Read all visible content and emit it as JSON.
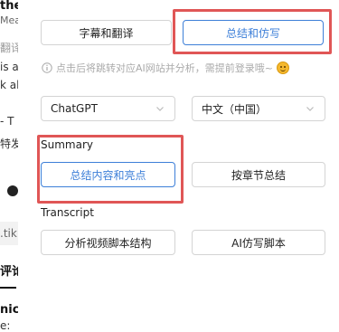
{
  "background_page": {
    "lines": [
      "the",
      "Mea",
      "翻译",
      "is a",
      "k al",
      "- T",
      "特发",
      ".tik",
      "评论",
      "nic",
      "e:"
    ]
  },
  "panel": {
    "tabs": [
      {
        "label": "字幕和翻译",
        "active": false
      },
      {
        "label": "总结和仿写",
        "active": true
      }
    ],
    "info_text": "点击后将跳转对应AI网站并分析，需提前登录哦~",
    "selects": {
      "ai_service": "ChatGPT",
      "language": "中文（中国）"
    },
    "summary": {
      "heading": "Summary",
      "buttons": [
        {
          "label": "总结内容和亮点",
          "active": true
        },
        {
          "label": "按章节总结",
          "active": false
        }
      ]
    },
    "transcript": {
      "heading": "Transcript",
      "buttons": [
        {
          "label": "分析视频脚本结构"
        },
        {
          "label": "AI仿写脚本"
        }
      ]
    }
  },
  "colors": {
    "accent": "#3d7fd8",
    "highlight": "#e05656",
    "border": "#d4d4d4",
    "muted_text": "#aaaaaa"
  }
}
